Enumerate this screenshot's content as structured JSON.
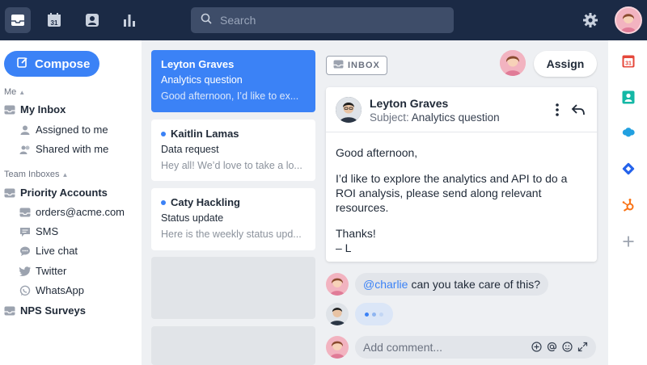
{
  "topbar": {
    "search_placeholder": "Search",
    "icons": [
      "inbox-icon",
      "calendar-icon",
      "contacts-icon",
      "analytics-icon"
    ],
    "calendar_day": "31"
  },
  "sidebar": {
    "compose_label": "Compose",
    "me_label": "Me",
    "my_inbox": "My Inbox",
    "assigned_to_me": "Assigned to me",
    "shared_with_me": "Shared with me",
    "team_inboxes_label": "Team Inboxes",
    "priority_accounts": "Priority Accounts",
    "channels": [
      {
        "label": "orders@acme.com",
        "icon": "inbox-icon"
      },
      {
        "label": "SMS",
        "icon": "sms-icon"
      },
      {
        "label": "Live chat",
        "icon": "chat-icon"
      },
      {
        "label": "Twitter",
        "icon": "twitter-icon"
      },
      {
        "label": "WhatsApp",
        "icon": "whatsapp-icon"
      }
    ],
    "nps_surveys": "NPS Surveys"
  },
  "list": {
    "cards": [
      {
        "name": "Leyton Graves",
        "subject": "Analytics question",
        "snippet": "Good afternoon, I’d like to ex...",
        "selected": true,
        "unread": false
      },
      {
        "name": "Kaitlin Lamas",
        "subject": "Data request",
        "snippet": "Hey all! We’d love to take a lo...",
        "selected": false,
        "unread": true
      },
      {
        "name": "Caty Hackling",
        "subject": "Status update",
        "snippet": "Here is the weekly status upd...",
        "selected": false,
        "unread": true
      }
    ]
  },
  "conversation": {
    "inbox_tag": "INBOX",
    "assign_label": "Assign",
    "message": {
      "from": "Leyton Graves",
      "subject_prefix": "Subject:",
      "subject": "Analytics question",
      "greeting": "Good afternoon,",
      "body": "I’d like to explore the analytics and API to do a ROI analysis, please send along relevant resources.",
      "thanks": "Thanks!",
      "sign": "– L"
    },
    "comment": {
      "mention": "@charlie",
      "text": "can you take care of this?"
    },
    "comment_placeholder": "Add comment...",
    "comment_tools": [
      "add-icon",
      "at-icon",
      "emoji-icon",
      "expand-icon"
    ]
  },
  "rail": {
    "calendar_day": "31",
    "integrations": [
      "calendar-icon",
      "contacts-icon",
      "salesforce-icon",
      "jira-icon",
      "hubspot-icon",
      "add-integration-icon"
    ]
  },
  "colors": {
    "topbar": "#1b2a45",
    "accent": "#3b82f6",
    "panel": "#eef0f3"
  }
}
